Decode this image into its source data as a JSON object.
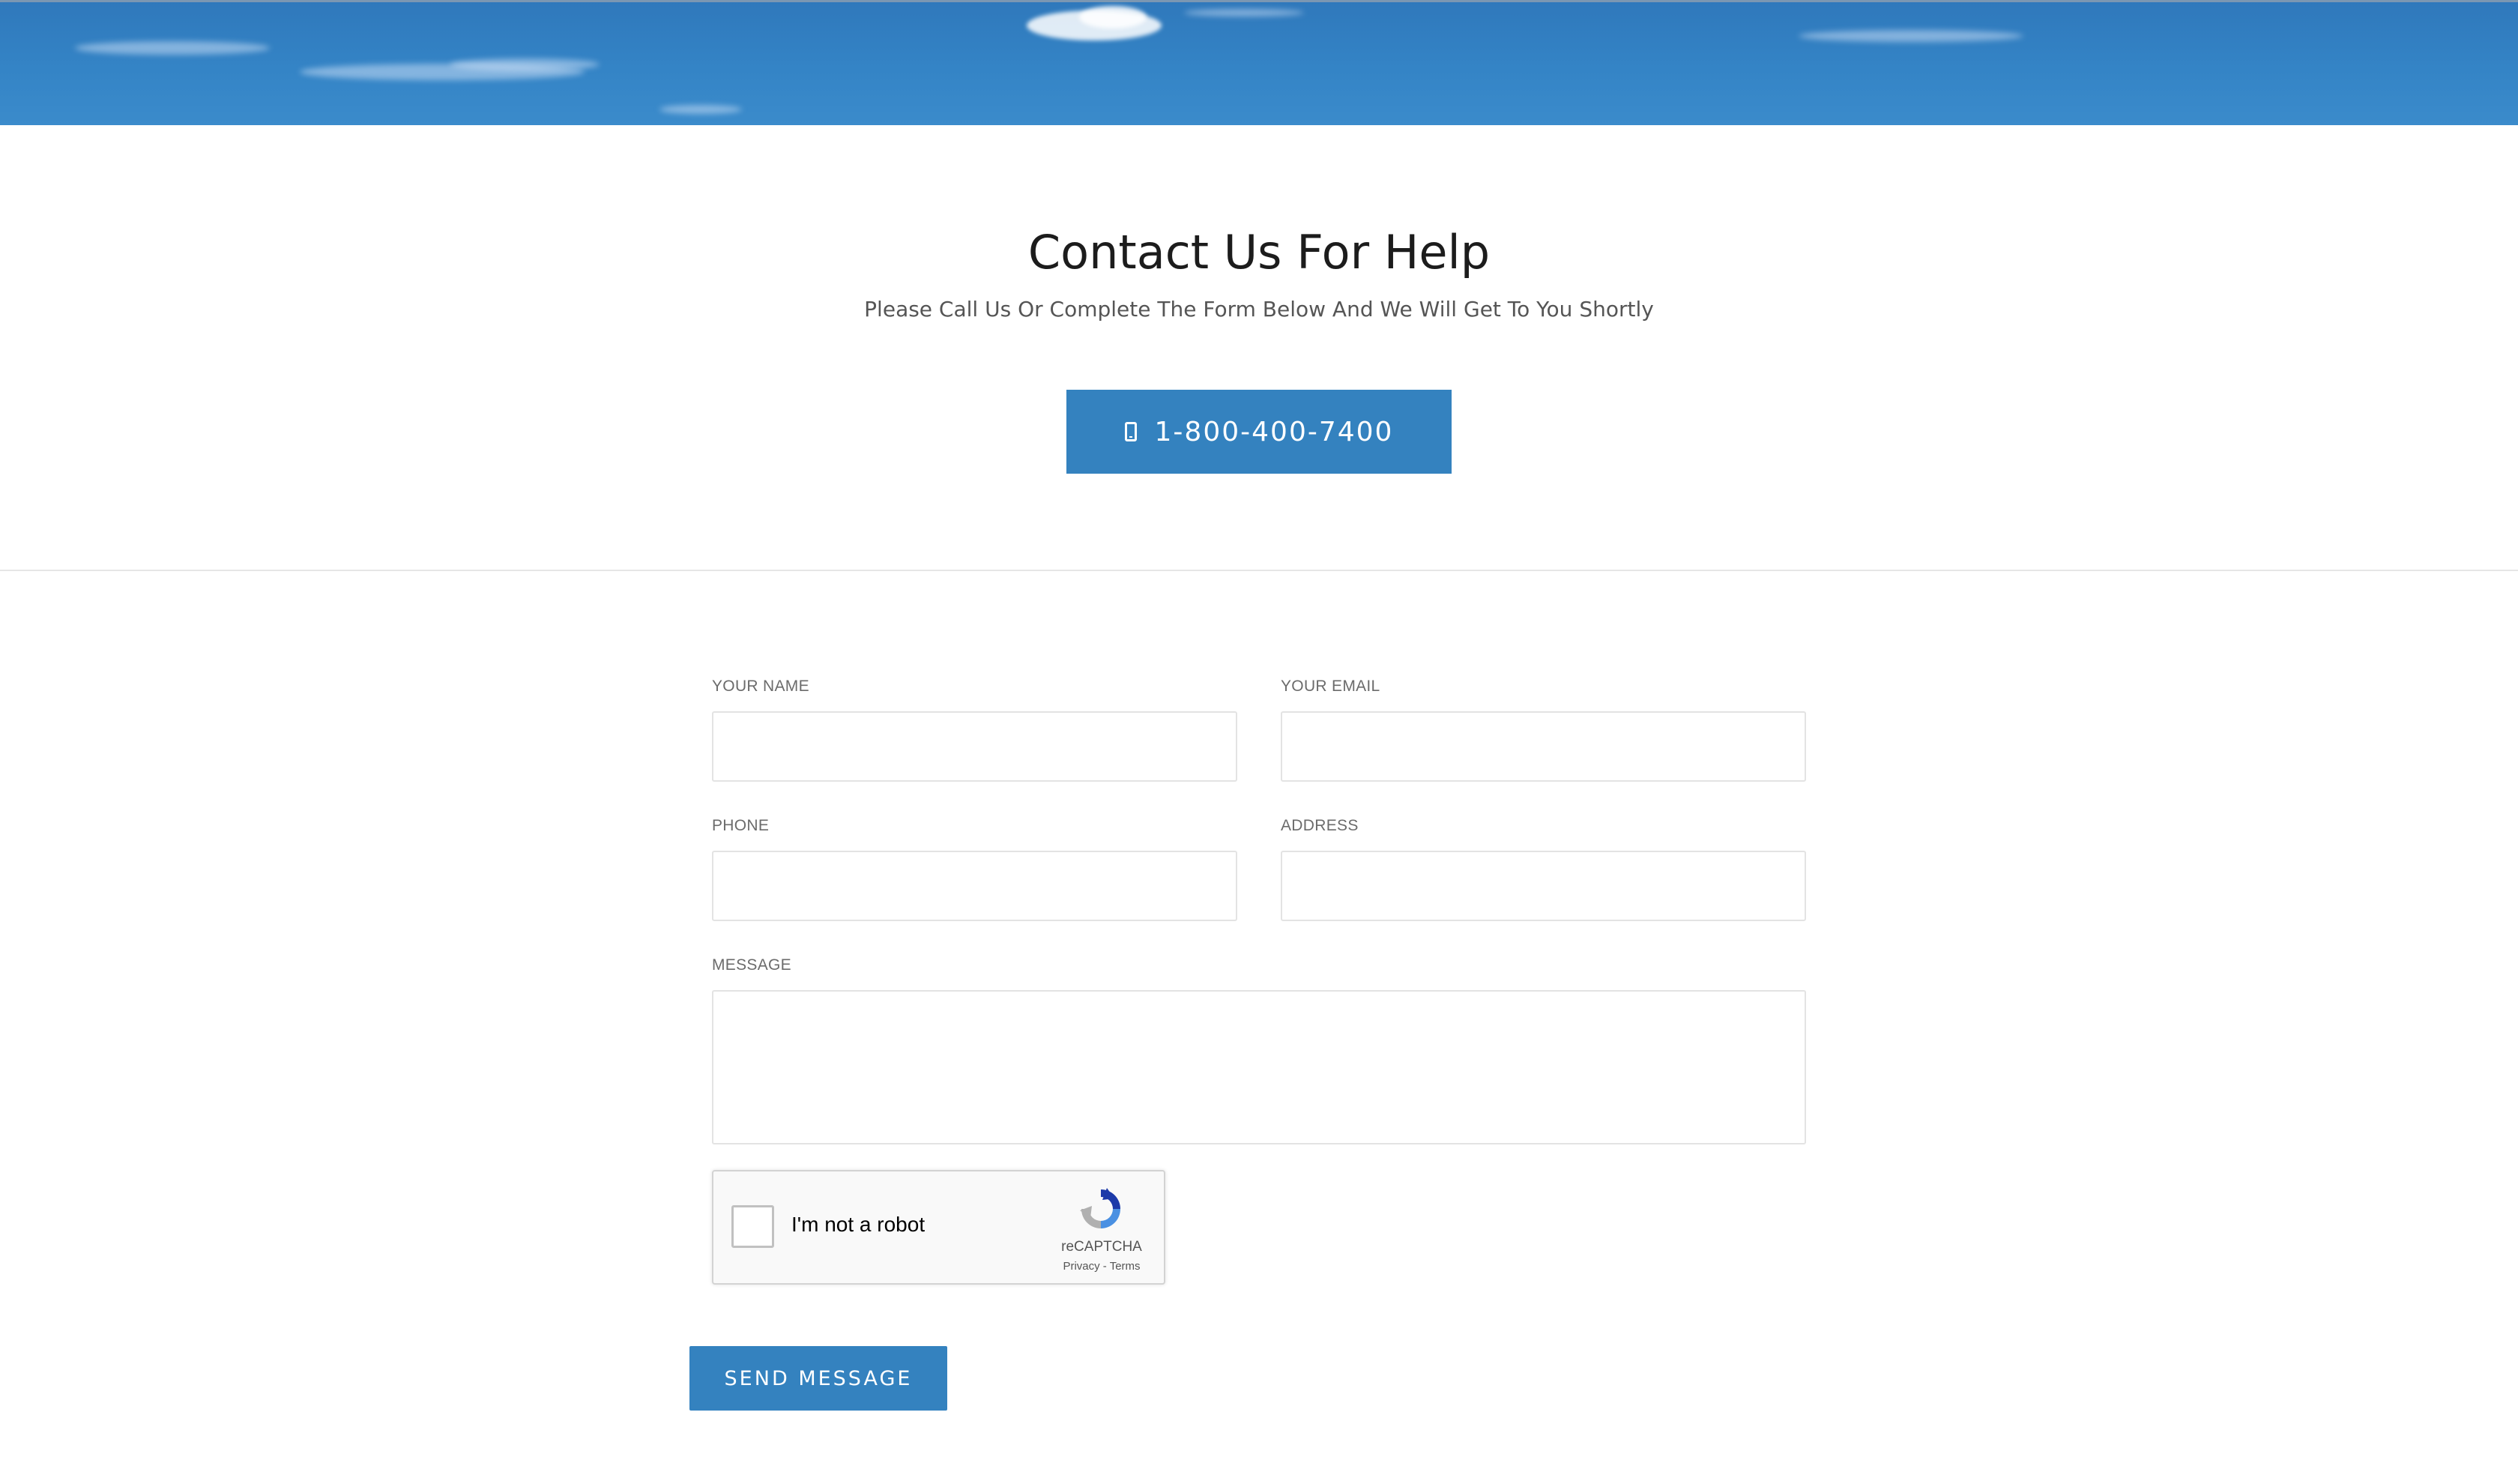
{
  "header": {
    "title": "Contact Us For Help",
    "subtitle": "Please Call Us Or Complete The Form Below And We Will Get To You Shortly",
    "phone_button_label": "1-800-400-7400",
    "phone_icon": "mobile-phone-icon"
  },
  "form": {
    "name": {
      "label": "YOUR NAME",
      "value": "",
      "placeholder": ""
    },
    "email": {
      "label": "YOUR EMAIL",
      "value": "",
      "placeholder": ""
    },
    "phone": {
      "label": "PHONE",
      "value": "",
      "placeholder": ""
    },
    "address": {
      "label": "ADDRESS",
      "value": "",
      "placeholder": ""
    },
    "message": {
      "label": "MESSAGE",
      "value": "",
      "placeholder": ""
    },
    "submit_label": "SEND MESSAGE"
  },
  "recaptcha": {
    "label": "I'm not a robot",
    "checked": false,
    "brand": "reCAPTCHA",
    "privacy": "Privacy",
    "separator": " - ",
    "terms": "Terms",
    "icon": "recaptcha-logo-icon"
  },
  "colors": {
    "accent": "#3482bf",
    "hero_sky": "#3484c6",
    "label_text": "#6b6b6b",
    "input_border": "#e3e3e3"
  }
}
